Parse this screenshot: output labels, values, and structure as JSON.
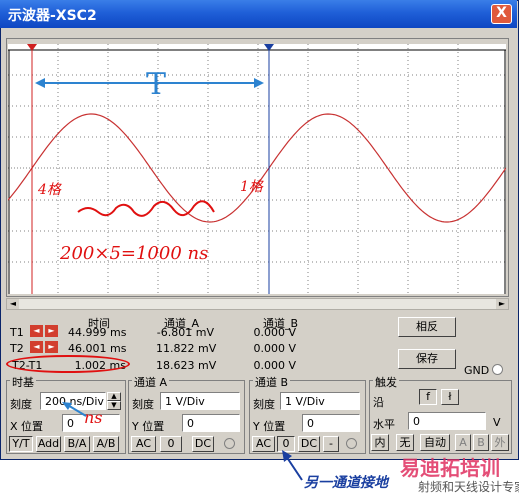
{
  "window": {
    "title": "示波器-XSC2",
    "close_glyph": "X"
  },
  "readout": {
    "headers": {
      "time": "时间",
      "ch_a": "通道_A",
      "ch_b": "通道_B"
    },
    "rows": [
      {
        "label": "T1",
        "time": "44.999 ms",
        "a": "-6.801 mV",
        "b": "0.000 V"
      },
      {
        "label": "T2",
        "time": "46.001 ms",
        "a": "11.822 mV",
        "b": "0.000 V"
      },
      {
        "label": "T2-T1",
        "time": "1.002 ms",
        "a": "18.623 mV",
        "b": "0.000 V"
      }
    ],
    "reverse_button": "相反",
    "save_button": "保存",
    "gnd_label": "GND"
  },
  "timebase": {
    "title": "时基",
    "scale_label": "刻度",
    "scale_value": "200 ns/Div",
    "xpos_label": "X 位置",
    "xpos_value": "0",
    "modes": [
      "Y/T",
      "Add",
      "B/A",
      "A/B"
    ]
  },
  "channel_a": {
    "title": "通道 A",
    "scale_label": "刻度",
    "scale_value": "1  V/Div",
    "ypos_label": "Y 位置",
    "ypos_value": "0",
    "coupling": [
      "AC",
      "0",
      "DC"
    ]
  },
  "channel_b": {
    "title": "通道 B",
    "scale_label": "刻度",
    "scale_value": "1  V/Div",
    "ypos_label": "Y 位置",
    "ypos_value": "0",
    "coupling": [
      "AC",
      "0",
      "DC",
      "-"
    ]
  },
  "trigger": {
    "title": "触发",
    "edge_label": "沿",
    "edge_buttons": [
      "f",
      "ł"
    ],
    "level_label": "水平",
    "level_value": "0",
    "level_unit": "V",
    "source_buttons": [
      "内",
      "无",
      "自动",
      "A",
      "B",
      "外"
    ]
  },
  "annotations": {
    "period": "T",
    "divisions": "4格",
    "cursor_label": "1格",
    "calc": "200×5=1000 ns",
    "scale_unit": "ns",
    "note": "另一通道接地"
  },
  "watermark": {
    "text": "易迪拓培训",
    "sub": "射频和天线设计专家"
  },
  "colors": {
    "titlebar": "#1f5fd8",
    "trace": "#c83232",
    "annotation": "#e01010",
    "cursor": "#1a3fa0",
    "note": "#1a3fa0",
    "screen_bg": "#ffffff"
  }
}
